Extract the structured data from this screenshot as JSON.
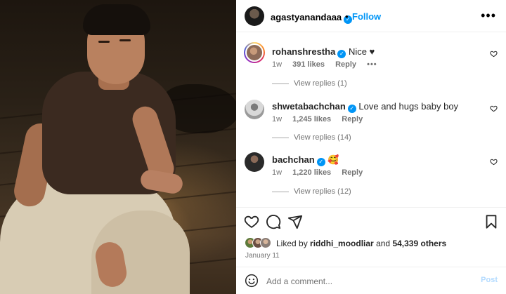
{
  "header": {
    "username": "agastyanandaaa",
    "verified": true,
    "separator": "•",
    "follow_label": "Follow",
    "more_label": "•••"
  },
  "comments": [
    {
      "username": "rohanshrestha",
      "verified": true,
      "text": "Nice ♥",
      "age": "1w",
      "likes": "391 likes",
      "reply_label": "Reply",
      "more_label": "•••",
      "view_replies": "View replies (1)",
      "avatar_ring": true
    },
    {
      "username": "shwetabachchan",
      "verified": true,
      "text": "Love and hugs baby boy",
      "age": "1w",
      "likes": "1,245 likes",
      "reply_label": "Reply",
      "view_replies": "View replies (14)"
    },
    {
      "username": "bachchan",
      "verified": true,
      "text": "🥰",
      "age": "1w",
      "likes": "1,220 likes",
      "reply_label": "Reply",
      "view_replies": "View replies (12)"
    }
  ],
  "actions": {
    "icons": [
      "heart-outline-icon",
      "comment-icon",
      "share-icon",
      "bookmark-icon"
    ]
  },
  "likes_row": {
    "prefix": "Liked by",
    "liker": "riddhi_moodliar",
    "conjunction": "and",
    "others": "54,339 others"
  },
  "post_date": "January 11",
  "comment_bar": {
    "placeholder": "Add a comment...",
    "post_label": "Post"
  },
  "colors": {
    "accent": "#0095f6",
    "post_disabled": "#b3dbff",
    "meta_gray": "#737373"
  }
}
